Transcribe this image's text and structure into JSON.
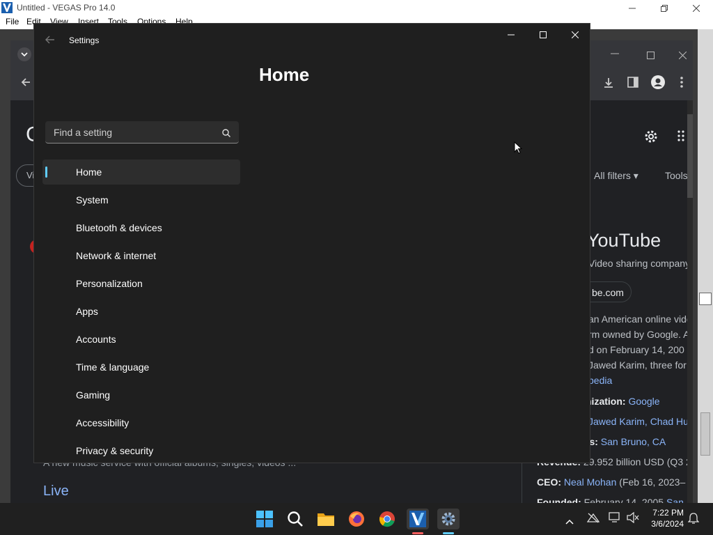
{
  "vegas": {
    "title": "Untitled - VEGAS Pro 14.0",
    "menu": [
      "File",
      "Edit",
      "View",
      "Insert",
      "Tools",
      "Options",
      "Help"
    ]
  },
  "chrome": {
    "search_filters": {
      "all_filters": "All filters",
      "tools": "Tools",
      "first_chip_partial": "Vi"
    },
    "knowledge_panel": {
      "title": "YouTube",
      "subtitle": "Video sharing company",
      "website": "be.com",
      "description_lines": [
        "an American online vide",
        "rm owned by Google. A",
        "d on February 14, 200",
        "Jawed Karim, three for"
      ],
      "source": "pedia",
      "facts": [
        {
          "label": "nization:",
          "value": "Google"
        },
        {
          "label": "",
          "value": "Jawed Karim, Chad Hu"
        },
        {
          "label": "rs:",
          "value": "San Bruno, CA"
        },
        {
          "label": "Revenue:",
          "value": "29.952 billion USD (Q3 2"
        },
        {
          "label": "CEO:",
          "value": "Neal Mohan",
          "extra": "(Feb 16, 2023–"
        },
        {
          "label": "Founded:",
          "value": "February 14, 2005",
          "extra": "San"
        }
      ]
    },
    "result_snippet": "A new music service with official albums, singles, videos ...",
    "live_link": "Live"
  },
  "settings": {
    "window_title": "Settings",
    "page_title": "Home",
    "search_placeholder": "Find a setting",
    "nav_items": [
      {
        "label": "Home",
        "active": true
      },
      {
        "label": "System"
      },
      {
        "label": "Bluetooth & devices"
      },
      {
        "label": "Network & internet"
      },
      {
        "label": "Personalization"
      },
      {
        "label": "Apps"
      },
      {
        "label": "Accounts"
      },
      {
        "label": "Time & language"
      },
      {
        "label": "Gaming"
      },
      {
        "label": "Accessibility"
      },
      {
        "label": "Privacy & security"
      }
    ]
  },
  "taskbar": {
    "icons": [
      "start-icon",
      "search-icon",
      "file-explorer-icon",
      "firefox-icon",
      "chrome-icon",
      "vegas-icon",
      "settings-icon"
    ],
    "time": "7:22 PM",
    "date": "3/6/2024"
  },
  "colors": {
    "accent": "#60cdff",
    "settings_bg": "#1f1f1f",
    "chrome_bg": "#202124",
    "link": "#8ab4f8"
  }
}
